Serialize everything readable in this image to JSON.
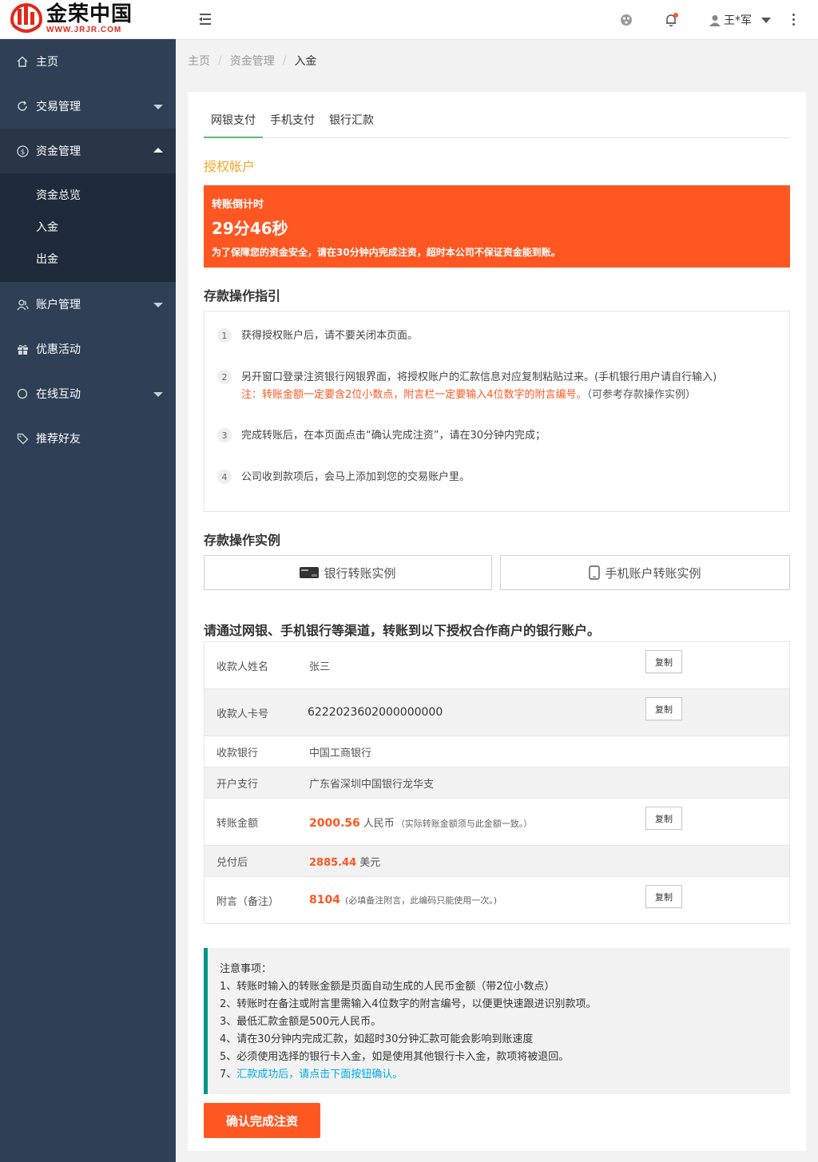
{
  "brand": {
    "name_cn": "金荣中国",
    "name_en": "WWW.JRJR.COM",
    "accent": "#e2281b"
  },
  "sidebar": {
    "items": [
      {
        "label": "主页",
        "icon": "home-icon"
      },
      {
        "label": "交易管理",
        "icon": "refresh-icon"
      },
      {
        "label": "资金管理",
        "icon": "dollar-circle-icon"
      },
      {
        "label": "账户管理",
        "icon": "user-group-icon"
      },
      {
        "label": "优惠活动",
        "icon": "gift-icon"
      },
      {
        "label": "在线互动",
        "icon": "chat-circle-icon"
      },
      {
        "label": "推荐好友",
        "icon": "tag-icon"
      }
    ],
    "subitems": [
      "资金总览",
      "入金",
      "出金"
    ]
  },
  "header": {
    "user": "王*军"
  },
  "breadcrumb": {
    "home": "主页",
    "section": "资金管理",
    "current": "入金"
  },
  "tabs": [
    "网银支付",
    "手机支付",
    "银行汇款"
  ],
  "auth_title": "授权帐户",
  "countdown": {
    "label": "转账倒计时",
    "time": "29分46秒",
    "note": "为了保障您的资金安全，请在30分钟内完成注资，超时本公司不保证资金能到账。"
  },
  "guide": {
    "title": "存款操作指引",
    "steps": [
      {
        "num": "1",
        "text": "获得授权账户后，请不要关闭本页面。"
      },
      {
        "num": "2",
        "text": "另开窗口登录注资银行网银界面，将授权账户的汇款信息对应复制粘贴过来。(手机银行用户请自行输入)",
        "warn": "注：转账金额一定要含2位小数点，附言栏一定要输入4位数字的附言编号。",
        "aside": "（可参考存款操作实例）"
      },
      {
        "num": "3",
        "text": "完成转账后，在本页面点击“确认完成注资”，请在30分钟内完成；"
      },
      {
        "num": "4",
        "text": "公司收到款项后，会马上添加到您的交易账户里。"
      }
    ]
  },
  "examples": {
    "title": "存款操作实例",
    "bank": "银行转账实例",
    "mobile": "手机账户转账实例"
  },
  "account": {
    "title": "请通过网银、手机银行等渠道，转账到以下授权合作商户的银行账户。",
    "copy_label": "复制",
    "rows": {
      "payee": {
        "key": "收款人姓名",
        "value": "张三"
      },
      "card": {
        "key": "收款人卡号",
        "value": "6222023602000000000"
      },
      "bank": {
        "key": "收款银行",
        "value": "中国工商银行"
      },
      "branch": {
        "key": "开户支行",
        "value": "广东省深圳中国银行龙华支"
      },
      "amount": {
        "key": "转账金额",
        "value": "2000.56",
        "unit": "人民币",
        "hint": "（实际转账金额须与此金额一致。）"
      },
      "exchange": {
        "key": "兑付后",
        "value": "2885.44",
        "unit": "美元"
      },
      "memo": {
        "key": "附言（备注）",
        "value": "8104",
        "hint": "(必填备注附言，此编码只能使用一次。)"
      }
    }
  },
  "notice": {
    "title": "注意事项：",
    "items": [
      "1、转账时输入的转账金额是页面自动生成的人民币金额（带2位小数点）",
      "2、转账时在备注或附言里需输入4位数字的附言编号，以便更快速跟进识别款项。",
      "3、最低汇款金额是500元人民币。",
      "4、请在30分钟内完成汇款，如超时30分钟汇款可能会影响到账速度",
      "5、必须使用选择的银行卡入金，如是使用其他银行卡入金，款项将被退回。"
    ],
    "last_prefix": "7、",
    "last_highlight": "汇款成功后，请点击下面按钮确认。"
  },
  "confirm_label": "确认完成注资",
  "colors": {
    "primary": "#ff5722",
    "sidebar": "#2f4056",
    "tab_active": "#5fb878",
    "notice_border": "#009688",
    "highlight": "#01aaed",
    "gold": "#f5a623"
  }
}
